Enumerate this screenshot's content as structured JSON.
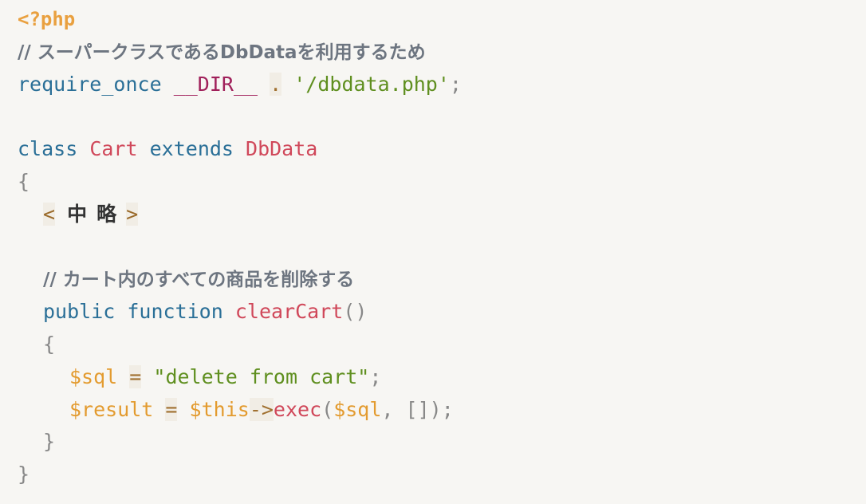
{
  "colors": {
    "background": "#f7f6f3",
    "php_tag": "#e9a03f",
    "comment": "#6d7580",
    "keyword": "#2a6f97",
    "class_name": "#d0485a",
    "magic_constant": "#a0205a",
    "string": "#5f8f1f",
    "variable": "#e39b2f",
    "punctuation": "#888888"
  },
  "code": {
    "php_open": "<?php",
    "comment_superclass": "// スーパークラスであるDbDataを利用するため",
    "require_once": "require_once",
    "dir_const": "__DIR__",
    "concat_dot": ".",
    "require_path": "'/dbdata.php'",
    "semicolon": ";",
    "class_kw": "class",
    "class_name": "Cart",
    "extends_kw": "extends",
    "parent_class": "DbData",
    "brace_open": "{",
    "brace_close": "}",
    "abbr_left": "<",
    "abbr_text": "中略",
    "abbr_right": ">",
    "comment_clear": "// カート内のすべての商品を削除する",
    "public_kw": "public",
    "function_kw": "function",
    "method_name": "clearCart",
    "parens": "()",
    "var_sql": "$sql",
    "assign": "=",
    "sql_string": "\"delete from cart\"",
    "var_result": "$result",
    "var_this": "$this",
    "arrow": "->",
    "exec_name": "exec",
    "paren_open": "(",
    "comma": ",",
    "empty_array": "[]",
    "paren_close": ")"
  }
}
